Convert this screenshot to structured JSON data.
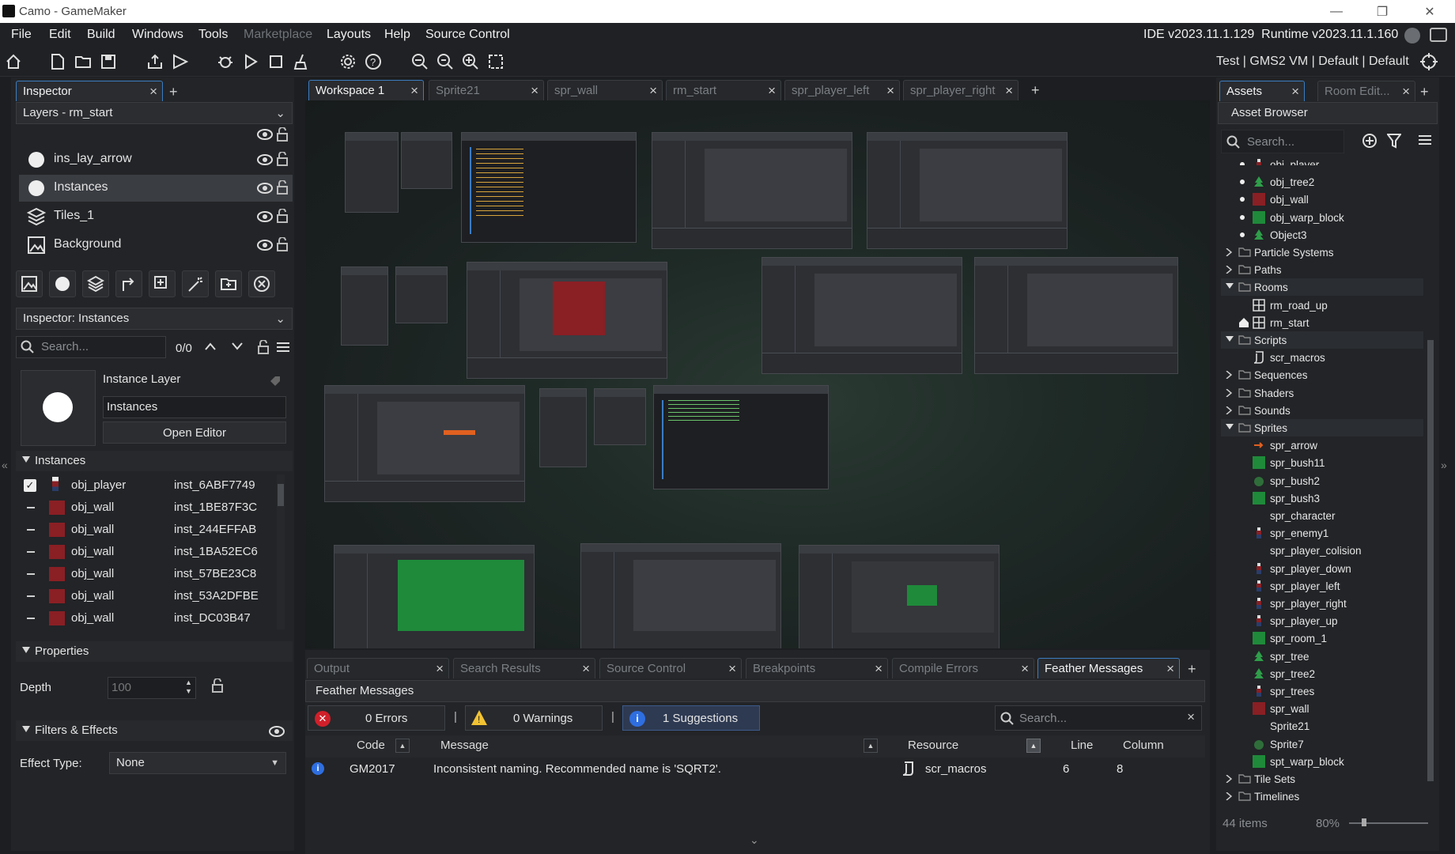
{
  "window": {
    "title": "Camo - GameMaker",
    "buttons": [
      "minimize",
      "restore",
      "close"
    ]
  },
  "menu": {
    "items": [
      "File",
      "Edit",
      "Build",
      "Windows",
      "Tools",
      "Marketplace",
      "Layouts",
      "Help",
      "Source Control"
    ],
    "version": "IDE v2023.11.1.129  Runtime v2023.11.1.160"
  },
  "toolbar": {
    "config": "Test | GMS2 VM | Default | Default"
  },
  "left": {
    "tab": "Inspector",
    "layers_dropdown": "Layers - rm_start",
    "layers": [
      {
        "name": "ins_lay_arrow",
        "icon": "instance-layer-icon"
      },
      {
        "name": "Instances",
        "icon": "instance-layer-icon",
        "selected": true
      },
      {
        "name": "Tiles_1",
        "icon": "tiles-layer-icon"
      },
      {
        "name": "Background",
        "icon": "background-layer-icon"
      }
    ],
    "inspector_dropdown": "Inspector: Instances",
    "search_placeholder": "Search...",
    "search_count": "0/0",
    "instance_layer_label": "Instance Layer",
    "instance_layer_name": "Instances",
    "open_editor": "Open Editor",
    "instances_header": "Instances",
    "instances": [
      {
        "obj": "obj_player",
        "id": "inst_6ABF7749",
        "checked": true
      },
      {
        "obj": "obj_wall",
        "id": "inst_1BE87F3C"
      },
      {
        "obj": "obj_wall",
        "id": "inst_244EFFAB"
      },
      {
        "obj": "obj_wall",
        "id": "inst_1BA52EC6"
      },
      {
        "obj": "obj_wall",
        "id": "inst_57BE23C8"
      },
      {
        "obj": "obj_wall",
        "id": "inst_53A2DFBE"
      },
      {
        "obj": "obj_wall",
        "id": "inst_DC03B47"
      }
    ],
    "properties_header": "Properties",
    "depth_label": "Depth",
    "depth_value": "100",
    "filters_header": "Filters & Effects",
    "effect_type_label": "Effect Type:",
    "effect_type_value": "None"
  },
  "center": {
    "tabs": [
      "Workspace 1",
      "Sprite21",
      "spr_wall",
      "rm_start",
      "spr_player_left",
      "spr_player_right"
    ],
    "bottom_tabs": [
      "Output",
      "Search Results",
      "Source Control",
      "Breakpoints",
      "Compile Errors",
      "Feather Messages"
    ],
    "fm_title": "Feather Messages",
    "errors": "0 Errors",
    "warnings": "0 Warnings",
    "suggestions": "1 Suggestions",
    "search_placeholder": "Search...",
    "columns": {
      "code": "Code",
      "message": "Message",
      "resource": "Resource",
      "line": "Line",
      "column": "Column"
    },
    "message_row": {
      "code": "GM2017",
      "message": "Inconsistent naming. Recommended name is 'SQRT2'.",
      "resource": "scr_macros",
      "line": "6",
      "column": "8"
    }
  },
  "right": {
    "tabs": [
      "Assets",
      "Room Edit..."
    ],
    "title": "Asset Browser",
    "search_placeholder": "Search...",
    "items": [
      {
        "t": "obj_player",
        "lvl": 2,
        "ic": "char",
        "cut": true
      },
      {
        "t": "obj_tree2",
        "lvl": 2,
        "ic": "tree"
      },
      {
        "t": "obj_wall",
        "lvl": 2,
        "ic": "red"
      },
      {
        "t": "obj_warp_block",
        "lvl": 2,
        "ic": "green"
      },
      {
        "t": "Object3",
        "lvl": 2,
        "ic": "tree"
      },
      {
        "t": "Particle Systems",
        "lvl": 0,
        "folder": true
      },
      {
        "t": "Paths",
        "lvl": 0,
        "folder": true
      },
      {
        "t": "Rooms",
        "lvl": 0,
        "folder": true,
        "open": true
      },
      {
        "t": "rm_road_up",
        "lvl": 1,
        "ic": "room"
      },
      {
        "t": "rm_start",
        "lvl": 1,
        "ic": "room",
        "home": true
      },
      {
        "t": "Scripts",
        "lvl": 0,
        "folder": true,
        "open": true
      },
      {
        "t": "scr_macros",
        "lvl": 1,
        "ic": "script"
      },
      {
        "t": "Sequences",
        "lvl": 0,
        "folder": true
      },
      {
        "t": "Shaders",
        "lvl": 0,
        "folder": true
      },
      {
        "t": "Sounds",
        "lvl": 0,
        "folder": true
      },
      {
        "t": "Sprites",
        "lvl": 0,
        "folder": true,
        "open": true
      },
      {
        "t": "spr_arrow",
        "lvl": 1,
        "ic": "arrow"
      },
      {
        "t": "spr_bush11",
        "lvl": 1,
        "ic": "green"
      },
      {
        "t": "spr_bush2",
        "lvl": 1,
        "ic": "bush"
      },
      {
        "t": "spr_bush3",
        "lvl": 1,
        "ic": "green"
      },
      {
        "t": "spr_character",
        "lvl": 1,
        "ic": "none"
      },
      {
        "t": "spr_enemy1",
        "lvl": 1,
        "ic": "char"
      },
      {
        "t": "spr_player_colision",
        "lvl": 1,
        "ic": "none"
      },
      {
        "t": "spr_player_down",
        "lvl": 1,
        "ic": "char"
      },
      {
        "t": "spr_player_left",
        "lvl": 1,
        "ic": "char"
      },
      {
        "t": "spr_player_right",
        "lvl": 1,
        "ic": "char"
      },
      {
        "t": "spr_player_up",
        "lvl": 1,
        "ic": "char"
      },
      {
        "t": "spr_room_1",
        "lvl": 1,
        "ic": "green"
      },
      {
        "t": "spr_tree",
        "lvl": 1,
        "ic": "tree"
      },
      {
        "t": "spr_tree2",
        "lvl": 1,
        "ic": "tree"
      },
      {
        "t": "spr_trees",
        "lvl": 1,
        "ic": "char"
      },
      {
        "t": "spr_wall",
        "lvl": 1,
        "ic": "red"
      },
      {
        "t": "Sprite21",
        "lvl": 1,
        "ic": "none"
      },
      {
        "t": "Sprite7",
        "lvl": 1,
        "ic": "bush"
      },
      {
        "t": "spt_warp_block",
        "lvl": 1,
        "ic": "green"
      },
      {
        "t": "Tile Sets",
        "lvl": 0,
        "folder": true
      },
      {
        "t": "Timelines",
        "lvl": 0,
        "folder": true
      }
    ],
    "count": "44 items",
    "zoom": "80%"
  },
  "colors": {
    "accent": "#3c7cc0",
    "wall_red": "#8a1f24",
    "green": "#1f8a3a",
    "error": "#d0202a",
    "warning": "#f1c232",
    "info": "#2e6ee0"
  }
}
